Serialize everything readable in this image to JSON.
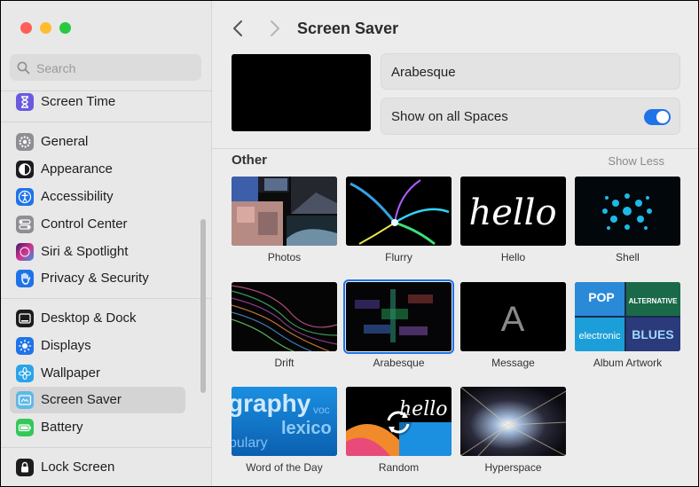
{
  "sidebar": {
    "search_placeholder": "Search",
    "items": [
      {
        "label": "Screen Time",
        "icon": "hourglass-icon"
      },
      {
        "label": "General",
        "icon": "gear-icon"
      },
      {
        "label": "Appearance",
        "icon": "appearance-icon"
      },
      {
        "label": "Accessibility",
        "icon": "accessibility-icon"
      },
      {
        "label": "Control Center",
        "icon": "control-center-icon"
      },
      {
        "label": "Siri & Spotlight",
        "icon": "siri-icon"
      },
      {
        "label": "Privacy & Security",
        "icon": "hand-icon"
      },
      {
        "label": "Desktop & Dock",
        "icon": "dock-icon"
      },
      {
        "label": "Displays",
        "icon": "sun-icon"
      },
      {
        "label": "Wallpaper",
        "icon": "flower-icon"
      },
      {
        "label": "Screen Saver",
        "icon": "screen-saver-icon",
        "selected": true
      },
      {
        "label": "Battery",
        "icon": "battery-icon"
      },
      {
        "label": "Lock Screen",
        "icon": "lock-icon"
      }
    ]
  },
  "main": {
    "title": "Screen Saver",
    "selected_saver": "Arabesque",
    "show_all_spaces_label": "Show on all Spaces",
    "show_all_spaces_on": true,
    "section_title": "Other",
    "show_less_label": "Show Less",
    "savers": [
      {
        "label": "Photos"
      },
      {
        "label": "Flurry"
      },
      {
        "label": "Hello"
      },
      {
        "label": "Shell"
      },
      {
        "label": "Drift"
      },
      {
        "label": "Arabesque",
        "selected": true
      },
      {
        "label": "Message",
        "thumb_text": "A"
      },
      {
        "label": "Album Artwork",
        "thumb_words": [
          "POP",
          "ALTERNATIVE",
          "electronic",
          "BLUES"
        ]
      },
      {
        "label": "Word of the Day",
        "thumb_words": [
          "graphy",
          "voc",
          "lexico",
          "bulary"
        ]
      },
      {
        "label": "Random",
        "thumb_text": "hello"
      },
      {
        "label": "Hyperspace"
      }
    ]
  },
  "colors": {
    "accent": "#1f73e8"
  }
}
